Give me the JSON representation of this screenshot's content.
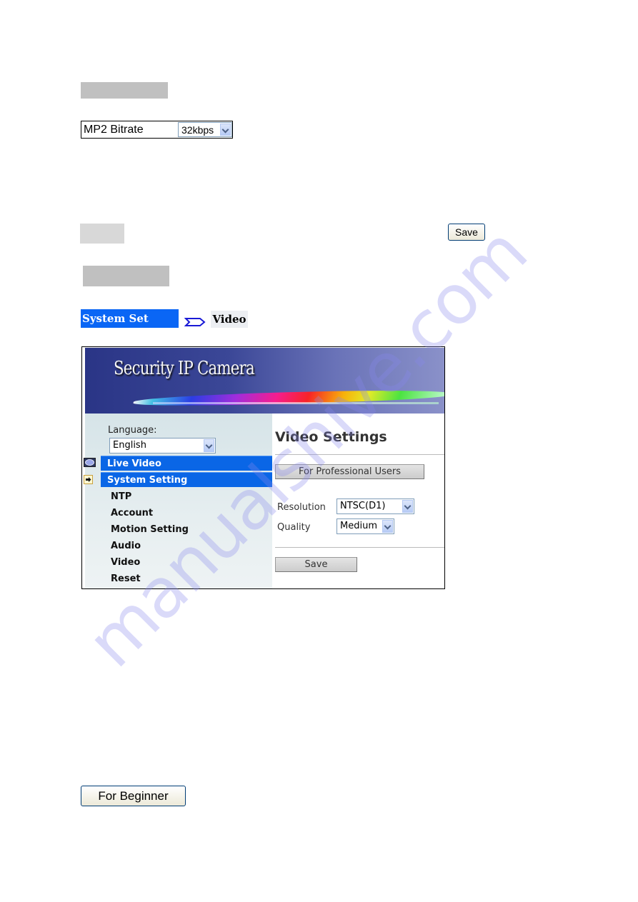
{
  "audio_section": {
    "heading_redacted": "",
    "mp2_bitrate": {
      "label": "MP2 Bitrate",
      "selected": "32kbps"
    },
    "save_label": "Save"
  },
  "breadcrumb": {
    "items": [
      "System Set",
      "Video"
    ],
    "separator_icon": "arrow-right-icon"
  },
  "camera_ui": {
    "banner_title": "Security IP Camera",
    "language": {
      "label": "Language:",
      "selected": "English"
    },
    "nav": {
      "main_items": [
        {
          "label": "Live Video",
          "icon": "camera-lens-icon"
        },
        {
          "label": "System Setting",
          "icon": "arrow-right-icon"
        }
      ],
      "sub_items": [
        "NTP",
        "Account",
        "Motion Setting",
        "Audio",
        "Video",
        "Reset"
      ]
    },
    "content": {
      "title": "Video Settings",
      "pro_button_label": "For Professional Users",
      "resolution": {
        "label": "Resolution",
        "selected": "NTSC(D1)"
      },
      "quality": {
        "label": "Quality",
        "selected": "Medium"
      },
      "save_label": "Save"
    }
  },
  "beginner_button_label": "For Beginner",
  "watermark": "manualshive.com"
}
